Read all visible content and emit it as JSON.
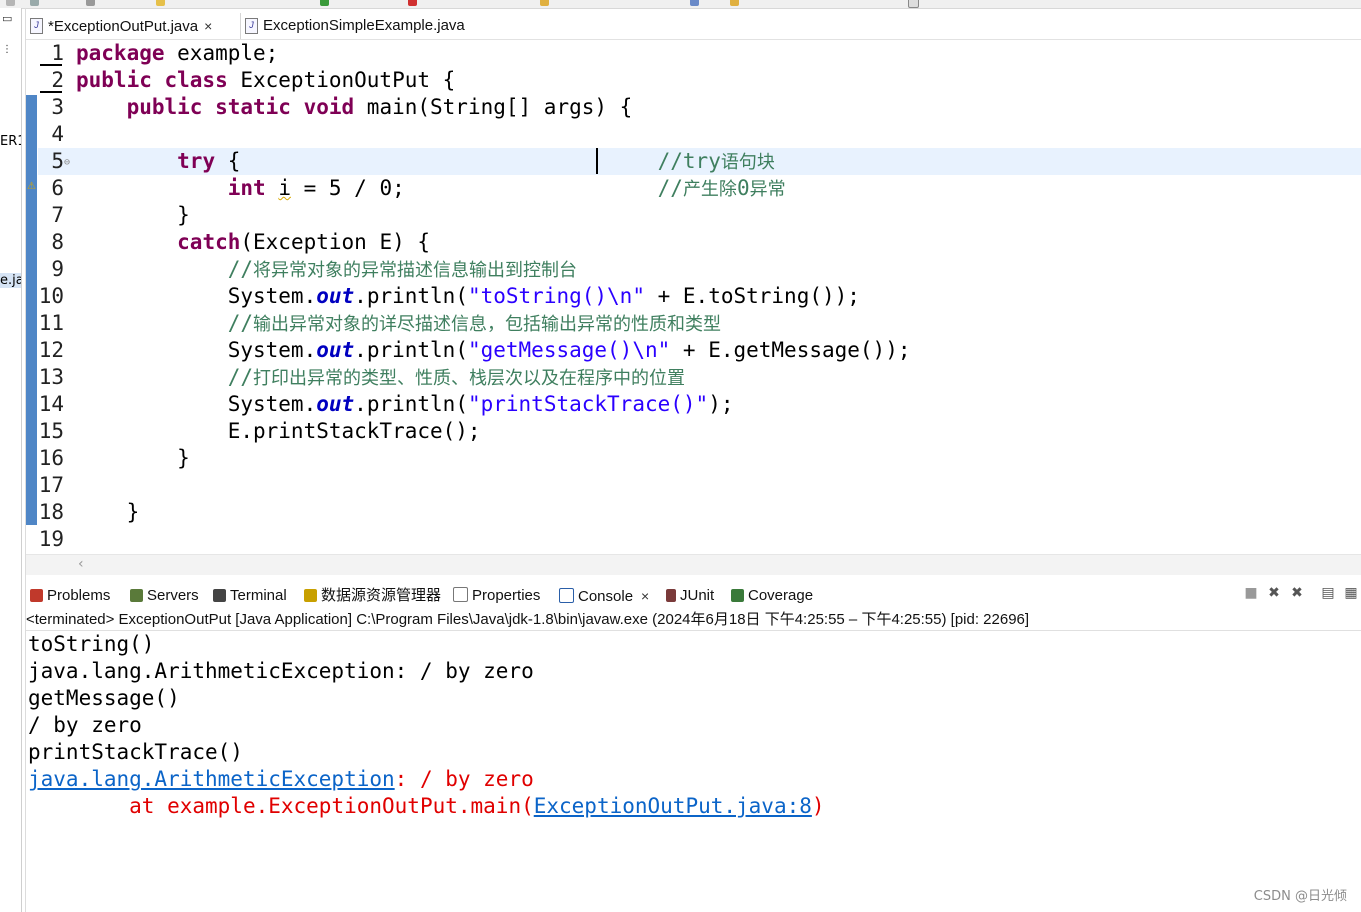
{
  "editor": {
    "tabs": [
      {
        "label": "*ExceptionOutPut.java",
        "close": "×",
        "icon": "java-file-icon",
        "active": true
      },
      {
        "label": "ExceptionSimpleExample.java",
        "icon": "java-file-icon",
        "active": false
      }
    ],
    "current_line": 5
  },
  "left_strip": {
    "cut_text_1": "ER1",
    "cut_text_2": "e.ja"
  },
  "code_lines": [
    {
      "n": "1"
    },
    {
      "n": "2"
    },
    {
      "n": "3"
    },
    {
      "n": "4"
    },
    {
      "n": "5"
    },
    {
      "n": "6"
    },
    {
      "n": "7"
    },
    {
      "n": "8"
    },
    {
      "n": "9"
    },
    {
      "n": "10"
    },
    {
      "n": "11"
    },
    {
      "n": "12"
    },
    {
      "n": "13"
    },
    {
      "n": "14"
    },
    {
      "n": "15"
    },
    {
      "n": "16"
    },
    {
      "n": "17"
    },
    {
      "n": "18"
    },
    {
      "n": "19"
    }
  ],
  "code": {
    "l1": {
      "kw": "package",
      "rest": " example;"
    },
    "l2": {
      "kw": "public class",
      "rest": " ExceptionOutPut {"
    },
    "l3": {
      "kw": "public static void",
      "rest": " main(String[] args) {"
    },
    "l5": {
      "kw": "try",
      "rest": " {",
      "comment": "//try",
      "comment_zh": "语句块"
    },
    "l6": {
      "kw": "int",
      "var": "i",
      "rest": " = 5 / 0;",
      "comment": "//",
      "comment_zh": "产生除",
      "comment2": "0",
      "comment_zh2": "异常"
    },
    "l7": {
      "rest": "}"
    },
    "l8": {
      "kw": "catch",
      "rest": "(Exception E) {"
    },
    "l9": {
      "comment": "//",
      "comment_zh": "将异常对象的异常描述信息输出到控制台"
    },
    "l10": {
      "a": "System.",
      "fld": "out",
      "b": ".println(",
      "str": "\"toString()\\n\"",
      "c": " + E.toString());"
    },
    "l11": {
      "comment": "//",
      "comment_zh": "输出异常对象的详尽描述信息，包括输出异常的性质和类型"
    },
    "l12": {
      "a": "System.",
      "fld": "out",
      "b": ".println(",
      "str": "\"getMessage()\\n\"",
      "c": " + E.getMessage());"
    },
    "l13": {
      "comment": "//",
      "comment_zh": "打印出异常的类型、性质、栈层次以及在程序中的位置"
    },
    "l14": {
      "a": "System.",
      "fld": "out",
      "b": ".println(",
      "str": "\"printStackTrace()\"",
      "c": ");"
    },
    "l15": {
      "rest": "E.printStackTrace();"
    },
    "l16": {
      "rest": "}"
    },
    "l18": {
      "rest": "}"
    }
  },
  "views": {
    "tabs": [
      {
        "label": "Problems",
        "icon": "problems-icon",
        "color": "#c0392b"
      },
      {
        "label": "Servers",
        "icon": "servers-icon",
        "color": "#5a7a3a"
      },
      {
        "label": "Terminal",
        "icon": "terminal-icon",
        "color": "#444444"
      },
      {
        "label": "数据源资源管理器",
        "icon": "datasource-icon",
        "color": "#c8a000"
      },
      {
        "label": "Properties",
        "icon": "properties-icon",
        "color": "#6a6a6a"
      },
      {
        "label": "Console",
        "icon": "console-icon",
        "color": "#2a5ea8",
        "active": true,
        "close": "×"
      },
      {
        "label": "JUnit",
        "icon": "junit-icon",
        "color": "#7a3a3a"
      },
      {
        "label": "Coverage",
        "icon": "coverage-icon",
        "color": "#3a7a3a"
      }
    ],
    "actions": [
      {
        "glyph": "■",
        "name": "terminate-icon"
      },
      {
        "glyph": "✖",
        "name": "remove-launch-icon"
      },
      {
        "glyph": "✖",
        "name": "remove-all-icon"
      },
      {
        "glyph": "▤",
        "name": "clear-console-icon"
      },
      {
        "glyph": "▦",
        "name": "scroll-lock-icon"
      }
    ]
  },
  "console": {
    "header": "<terminated> ExceptionOutPut [Java Application] C:\\Program Files\\Java\\jdk-1.8\\bin\\javaw.exe  (2024年6月18日 下午4:25:55 – 下午4:25:55) [pid: 22696]",
    "lines": {
      "o1": "toString()",
      "o2": "java.lang.ArithmeticException: / by zero",
      "o3": "getMessage()",
      "o4": "/ by zero",
      "o5": "printStackTrace()",
      "o6_link": "java.lang.ArithmeticException",
      "o6_rest": ": / by zero",
      "o7_pre": "\tat example.ExceptionOutPut.main(",
      "o7_link": "ExceptionOutPut.java:8",
      "o7_post": ")"
    }
  },
  "watermark": "CSDN @日光倾"
}
